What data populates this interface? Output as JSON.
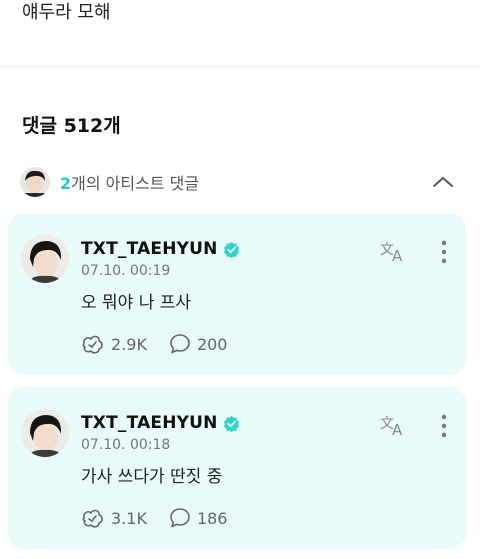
{
  "post": {
    "text": "얘두라 모해"
  },
  "comments_header": {
    "title": "댓글 512개"
  },
  "artist_comments": {
    "count": "2",
    "label": "개의 아티스트 댓글",
    "collapse_icon": "chevron-up-icon"
  },
  "comments": [
    {
      "author": "TXT_TAEHYUN",
      "verified_icon": "verified-badge-icon",
      "time": "07.10. 00:19",
      "text": "오 뭐야 나 프사",
      "likes": "2.9K",
      "replies": "200"
    },
    {
      "author": "TXT_TAEHYUN",
      "verified_icon": "verified-badge-icon",
      "time": "07.10. 00:18",
      "text": "가사 쓰다가 딴짓 중",
      "likes": "3.1K",
      "replies": "186"
    }
  ],
  "colors": {
    "accent": "#1ecbc4",
    "card_bg": "#e8fbf8",
    "badge": "#2ed3cf",
    "muted": "#666666"
  }
}
